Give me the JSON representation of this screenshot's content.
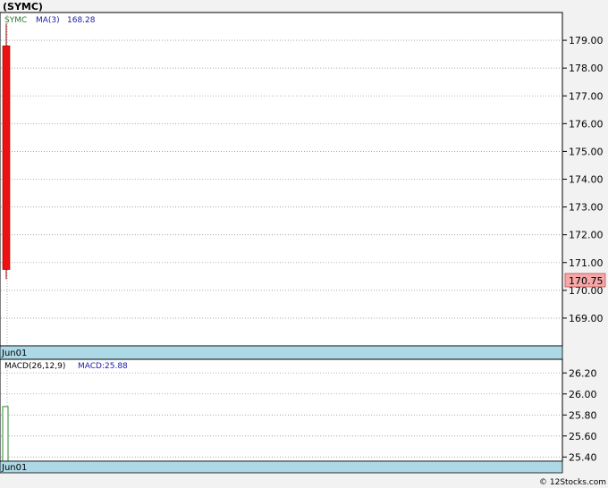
{
  "title": "(SYMC)",
  "footer": "© 12Stocks.com",
  "colors": {
    "candle_down": "#ee1111",
    "ma_label": "#1a1aa6",
    "symbol_label": "#2a7a2a",
    "date_band": "#add8e6",
    "price_badge": "#f4a8a8",
    "macd_bar_border": "#2e8b2e"
  },
  "chart_data": [
    {
      "type": "candlestick",
      "symbol": "SYMC",
      "legend": {
        "symbol": "SYMC",
        "ma_label": "MA(3)",
        "ma_value": "168.28"
      },
      "candles": [
        {
          "date": "Jun01",
          "open": 178.8,
          "high": 179.6,
          "low": 170.4,
          "close": 170.75
        }
      ],
      "last_price": "170.75",
      "yticks": [
        "179.00",
        "178.00",
        "177.00",
        "176.00",
        "175.00",
        "174.00",
        "173.00",
        "172.00",
        "171.00",
        "170.00",
        "169.00"
      ],
      "ylim": [
        168.0,
        180.0
      ],
      "xlabel_dates": [
        "Jun01"
      ],
      "grid": true
    },
    {
      "type": "bar",
      "indicator": "MACD",
      "legend": {
        "params": "MACD(26,12,9)",
        "value_label": "MACD:25.88"
      },
      "bars": [
        {
          "date": "Jun01",
          "value": 25.88
        }
      ],
      "yticks": [
        "26.20",
        "26.00",
        "25.80",
        "25.60",
        "25.40"
      ],
      "ylim": [
        25.36,
        26.33
      ],
      "xlabel_dates": [
        "Jun01"
      ],
      "grid": true
    }
  ]
}
